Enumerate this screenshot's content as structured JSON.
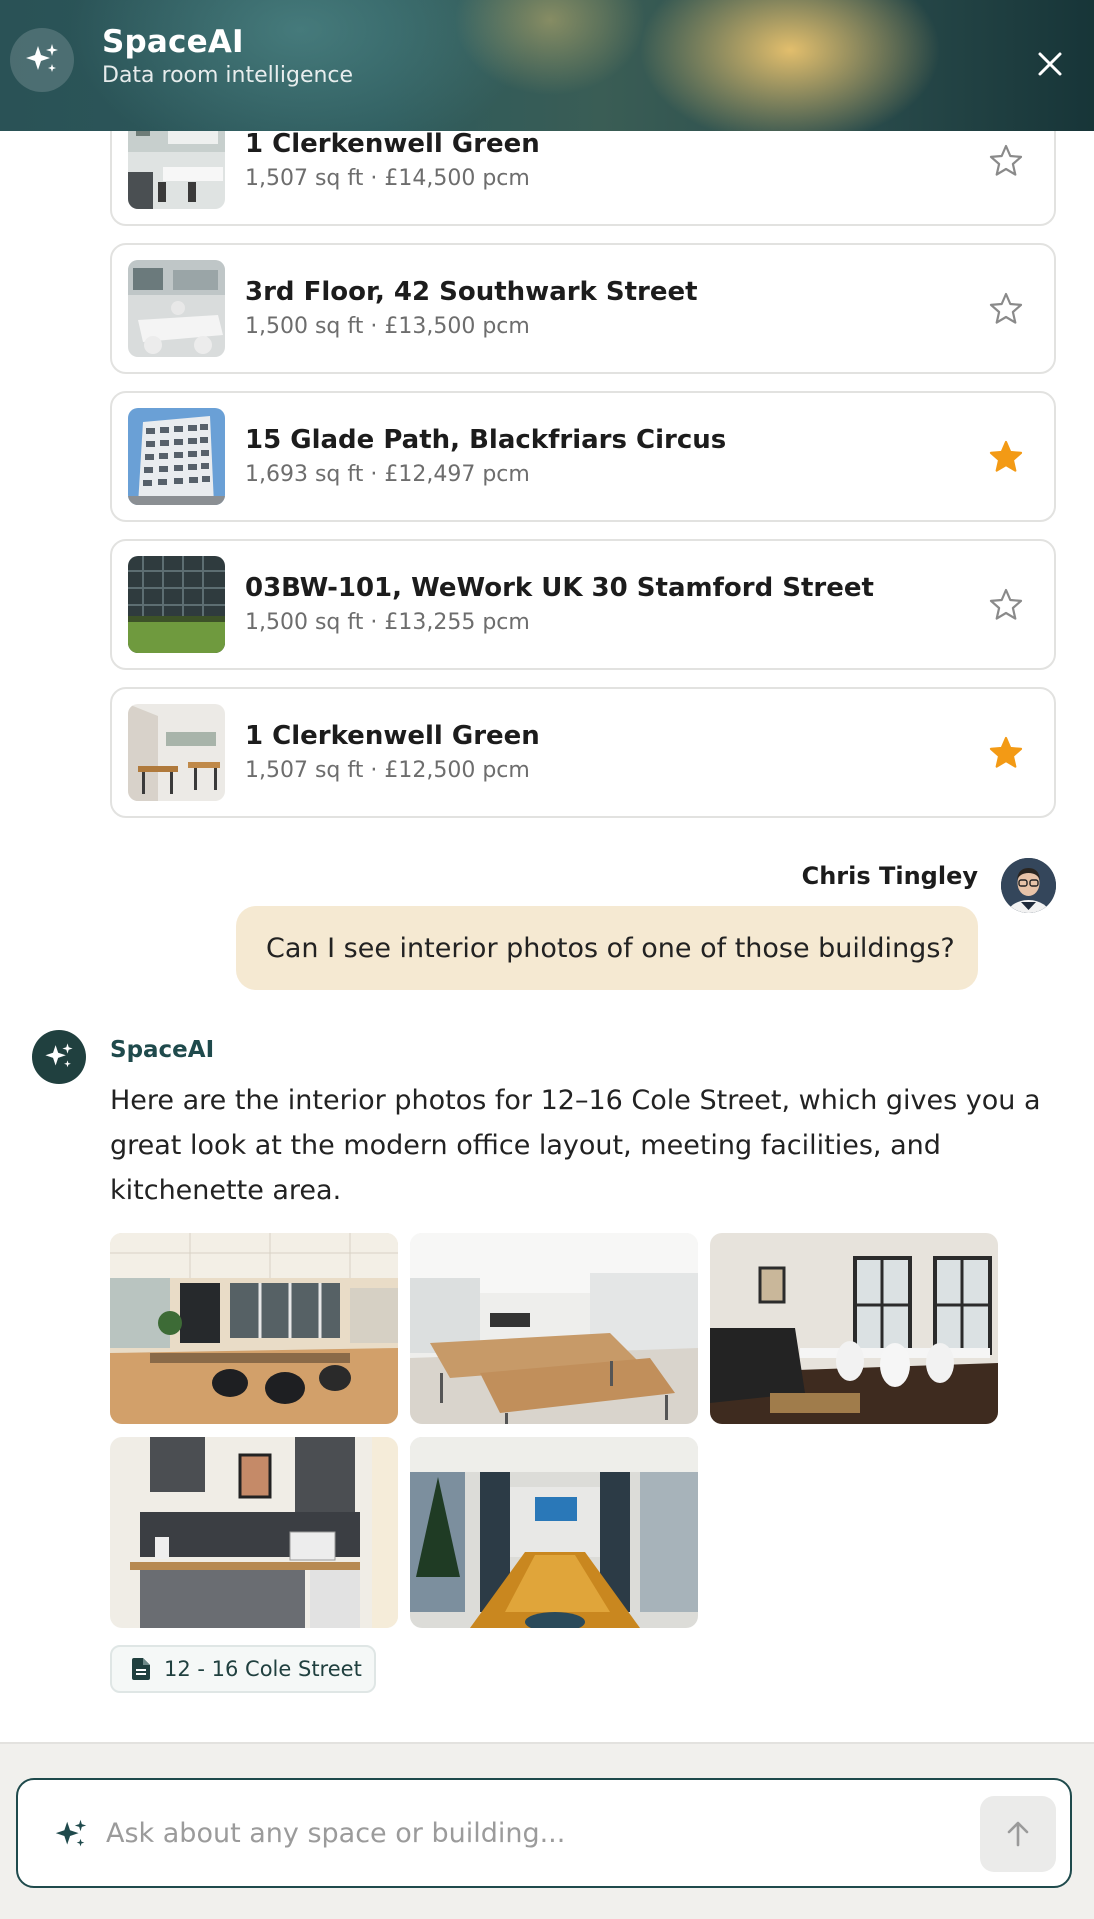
{
  "app": {
    "title": "SpaceAI",
    "subtitle": "Data room intelligence",
    "accent_color": "#1f4a4c",
    "star_color": "#f39a15"
  },
  "properties": [
    {
      "name": "1 Clerkenwell Green",
      "meta": "1,507 sq ft · £14,500 pcm",
      "starred": false
    },
    {
      "name": "3rd Floor, 42 Southwark Street",
      "meta": "1,500 sq ft · £13,500 pcm",
      "starred": false
    },
    {
      "name": "15 Glade Path, Blackfriars Circus",
      "meta": "1,693 sq ft · £12,497 pcm",
      "starred": true
    },
    {
      "name": "03BW-101, WeWork UK 30 Stamford Street",
      "meta": "1,500 sq ft · £13,255 pcm",
      "starred": false
    },
    {
      "name": "1 Clerkenwell Green",
      "meta": "1,507 sq ft · £12,500 pcm",
      "starred": true
    }
  ],
  "user_message": {
    "author": "Chris Tingley",
    "text": "Can I see interior photos of one of those buildings?"
  },
  "ai_message": {
    "author": "SpaceAI",
    "text": "Here are the interior photos for 12–16 Cole Street, which gives you a great look at the modern office layout, meeting facilities, and kitchenette area.",
    "photos": [
      "open-plan-office",
      "desk-area",
      "meeting-room-with-sofa",
      "kitchenette",
      "boardroom"
    ],
    "source": "12 - 16 Cole Street"
  },
  "input": {
    "placeholder": "Ask about any space or building..."
  },
  "icons": [
    "sparkle-icon",
    "close-icon",
    "star-icon",
    "document-icon",
    "arrow-up-icon"
  ]
}
